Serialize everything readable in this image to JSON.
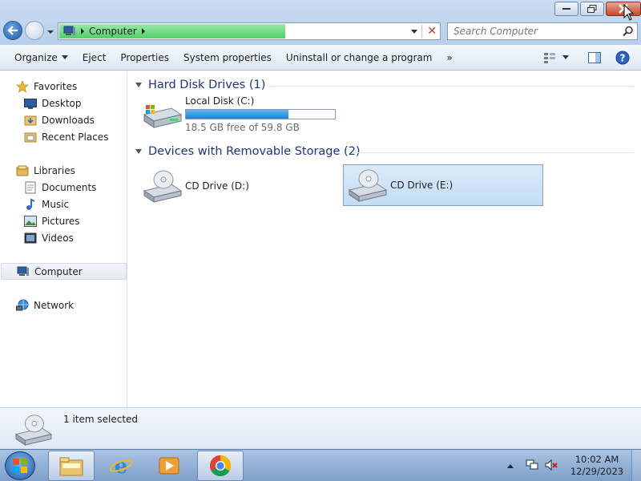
{
  "address": {
    "location": "Computer"
  },
  "search": {
    "placeholder": "Search Computer"
  },
  "toolbar": {
    "organize": "Organize",
    "eject": "Eject",
    "properties": "Properties",
    "system_properties": "System properties",
    "uninstall": "Uninstall or change a program",
    "more": "»"
  },
  "nav": {
    "favorites": "Favorites",
    "desktop": "Desktop",
    "downloads": "Downloads",
    "recent_places": "Recent Places",
    "libraries": "Libraries",
    "documents": "Documents",
    "music": "Music",
    "pictures": "Pictures",
    "videos": "Videos",
    "computer": "Computer",
    "network": "Network"
  },
  "groups": {
    "hdd": "Hard Disk Drives (1)",
    "removable": "Devices with Removable Storage (2)"
  },
  "drives": {
    "c": {
      "name": "Local Disk (C:)",
      "free": "18.5 GB free of 59.8 GB",
      "used_fraction": 0.69
    },
    "d": {
      "name": "CD Drive (D:)"
    },
    "e": {
      "name": "CD Drive (E:)"
    }
  },
  "details": {
    "status": "1 item selected"
  },
  "taskbar": {
    "time": "10:02 AM",
    "date": "12/29/2023"
  },
  "colors": {
    "accent": "#1a86d8",
    "group_header": "#1e3287",
    "selection": "#c3dcf5"
  }
}
